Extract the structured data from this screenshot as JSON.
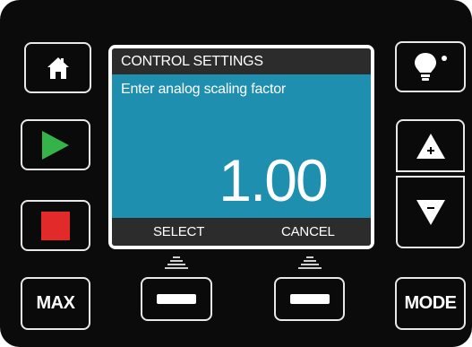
{
  "screen": {
    "title": "CONTROL SETTINGS",
    "prompt": "Enter analog scaling factor",
    "value": "1.00",
    "softkeys": {
      "left": "SELECT",
      "right": "CANCEL"
    },
    "colors": {
      "background": "#1f8fb0",
      "bars": "#2c2c2c"
    }
  },
  "buttons": {
    "home": {
      "icon": "home-icon"
    },
    "run": {
      "icon": "play-icon",
      "color": "#35b34a"
    },
    "stop": {
      "icon": "stop-icon",
      "color": "#e32a2a"
    },
    "max_label": "MAX",
    "light": {
      "icon": "lightbulb-icon"
    },
    "up": {
      "icon": "up-arrow-plus-icon"
    },
    "down": {
      "icon": "down-arrow-minus-icon"
    },
    "mode_label": "MODE",
    "soft1": {
      "icon": "softkey-bar-icon"
    },
    "soft2": {
      "icon": "softkey-bar-icon"
    }
  }
}
